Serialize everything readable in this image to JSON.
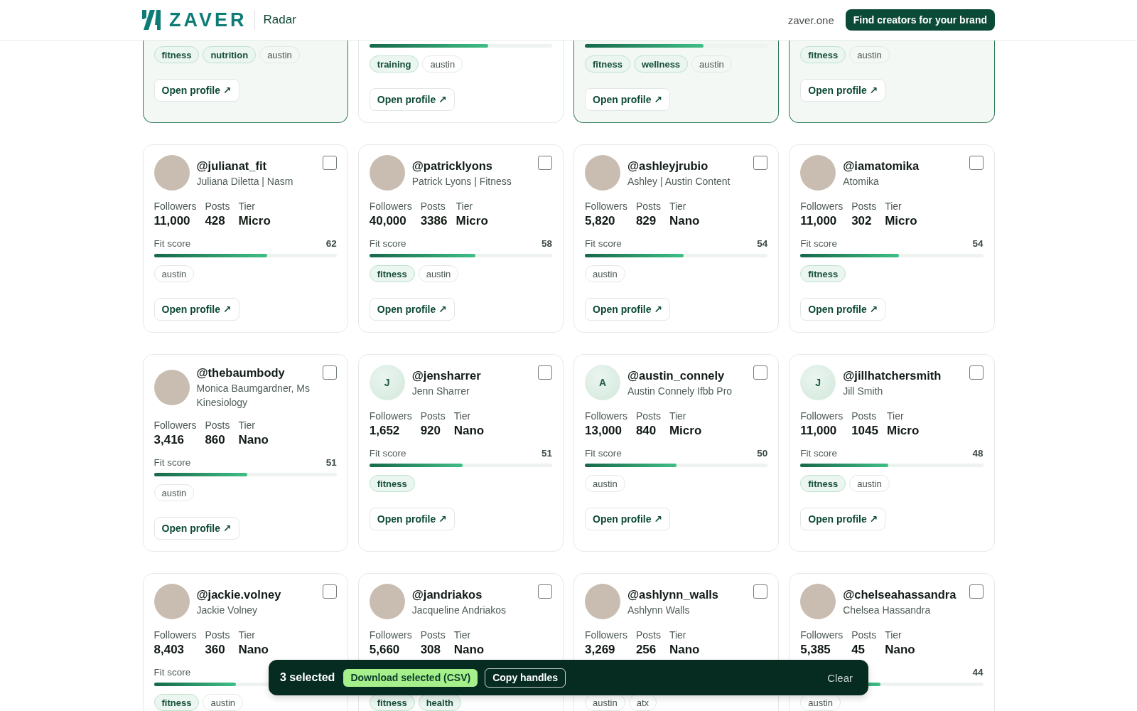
{
  "header": {
    "logo_text": "ZAVER",
    "product": "Radar",
    "site_link": "zaver.one",
    "cta": "Find creators for your brand"
  },
  "cards": [
    {
      "selected": true,
      "tags": [
        {
          "text": "fitness",
          "kind": "niche"
        },
        {
          "text": "nutrition",
          "kind": "niche"
        },
        {
          "text": "austin",
          "kind": "location"
        }
      ],
      "open_button": "Open profile ↗"
    },
    {
      "selected": false,
      "fit": {
        "level": 0.65
      },
      "tags": [
        {
          "text": "training",
          "kind": "niche"
        },
        {
          "text": "austin",
          "kind": "location"
        }
      ],
      "open_button": "Open profile ↗"
    },
    {
      "selected": true,
      "fit": {
        "level": 0.65
      },
      "tags": [
        {
          "text": "fitness",
          "kind": "niche"
        },
        {
          "text": "wellness",
          "kind": "niche"
        },
        {
          "text": "austin",
          "kind": "location"
        }
      ],
      "open_button": "Open profile ↗"
    },
    {
      "selected": true,
      "tags": [
        {
          "text": "fitness",
          "kind": "niche"
        },
        {
          "text": "austin",
          "kind": "location"
        }
      ],
      "open_button": "Open profile ↗"
    },
    {
      "selected": false,
      "avatar": {
        "kind": "photo"
      },
      "handle": "@julianat_fit",
      "name": "Juliana Diletta | Nasm",
      "checkbox": {
        "checked": false
      },
      "stats": [
        {
          "label": "Followers",
          "value": "11,000"
        },
        {
          "label": "Posts",
          "value": "428"
        },
        {
          "label": "Tier",
          "value": "Micro"
        }
      ],
      "fit": {
        "label": "Fit score",
        "score": "62",
        "level": 0.62
      },
      "tags": [
        {
          "text": "austin",
          "kind": "location"
        }
      ],
      "open_button": "Open profile ↗"
    },
    {
      "selected": false,
      "avatar": {
        "kind": "photo"
      },
      "handle": "@patricklyons",
      "name": "Patrick Lyons | Fitness",
      "checkbox": {
        "checked": false
      },
      "stats": [
        {
          "label": "Followers",
          "value": "40,000"
        },
        {
          "label": "Posts",
          "value": "3386"
        },
        {
          "label": "Tier",
          "value": "Micro"
        }
      ],
      "fit": {
        "label": "Fit score",
        "score": "58",
        "level": 0.58
      },
      "tags": [
        {
          "text": "fitness",
          "kind": "niche"
        },
        {
          "text": "austin",
          "kind": "location"
        }
      ],
      "open_button": "Open profile ↗"
    },
    {
      "selected": false,
      "avatar": {
        "kind": "photo"
      },
      "handle": "@ashleyjrubio",
      "name": "Ashley | Austin Content",
      "checkbox": {
        "checked": false
      },
      "stats": [
        {
          "label": "Followers",
          "value": "5,820"
        },
        {
          "label": "Posts",
          "value": "829"
        },
        {
          "label": "Tier",
          "value": "Nano"
        }
      ],
      "fit": {
        "label": "Fit score",
        "score": "54",
        "level": 0.54
      },
      "tags": [
        {
          "text": "austin",
          "kind": "location"
        }
      ],
      "open_button": "Open profile ↗"
    },
    {
      "selected": false,
      "avatar": {
        "kind": "photo"
      },
      "handle": "@iamatomika",
      "name": "Atomika",
      "checkbox": {
        "checked": false
      },
      "stats": [
        {
          "label": "Followers",
          "value": "11,000"
        },
        {
          "label": "Posts",
          "value": "302"
        },
        {
          "label": "Tier",
          "value": "Micro"
        }
      ],
      "fit": {
        "label": "Fit score",
        "score": "54",
        "level": 0.54
      },
      "tags": [
        {
          "text": "fitness",
          "kind": "niche"
        }
      ],
      "open_button": "Open profile ↗"
    },
    {
      "selected": false,
      "avatar": {
        "kind": "photo"
      },
      "handle": "@thebaumbody",
      "name": "Monica Baumgardner, Ms Kinesiology",
      "checkbox": {
        "checked": false
      },
      "stats": [
        {
          "label": "Followers",
          "value": "3,416"
        },
        {
          "label": "Posts",
          "value": "860"
        },
        {
          "label": "Tier",
          "value": "Nano"
        }
      ],
      "fit": {
        "label": "Fit score",
        "score": "51",
        "level": 0.51
      },
      "tags": [
        {
          "text": "austin",
          "kind": "location"
        }
      ],
      "open_button": "Open profile ↗"
    },
    {
      "selected": false,
      "avatar": {
        "kind": "initial",
        "initial": "J"
      },
      "handle": "@jensharrer",
      "name": "Jenn Sharrer",
      "checkbox": {
        "checked": false
      },
      "stats": [
        {
          "label": "Followers",
          "value": "1,652"
        },
        {
          "label": "Posts",
          "value": "920"
        },
        {
          "label": "Tier",
          "value": "Nano"
        }
      ],
      "fit": {
        "label": "Fit score",
        "score": "51",
        "level": 0.51
      },
      "tags": [
        {
          "text": "fitness",
          "kind": "niche"
        }
      ],
      "open_button": "Open profile ↗"
    },
    {
      "selected": false,
      "avatar": {
        "kind": "initial",
        "initial": "A"
      },
      "handle": "@austin_connely",
      "name": "Austin Connely Ifbb Pro",
      "checkbox": {
        "checked": false
      },
      "stats": [
        {
          "label": "Followers",
          "value": "13,000"
        },
        {
          "label": "Posts",
          "value": "840"
        },
        {
          "label": "Tier",
          "value": "Micro"
        }
      ],
      "fit": {
        "label": "Fit score",
        "score": "50",
        "level": 0.5
      },
      "tags": [
        {
          "text": "austin",
          "kind": "location"
        }
      ],
      "open_button": "Open profile ↗"
    },
    {
      "selected": false,
      "avatar": {
        "kind": "initial",
        "initial": "J"
      },
      "handle": "@jillhatchersmith",
      "name": "Jill Smith",
      "checkbox": {
        "checked": false
      },
      "stats": [
        {
          "label": "Followers",
          "value": "11,000"
        },
        {
          "label": "Posts",
          "value": "1045"
        },
        {
          "label": "Tier",
          "value": "Micro"
        }
      ],
      "fit": {
        "label": "Fit score",
        "score": "48",
        "level": 0.48
      },
      "tags": [
        {
          "text": "fitness",
          "kind": "niche"
        },
        {
          "text": "austin",
          "kind": "location"
        }
      ],
      "open_button": "Open profile ↗"
    },
    {
      "selected": false,
      "avatar": {
        "kind": "photo"
      },
      "handle": "@jackie.volney",
      "name": "Jackie Volney",
      "checkbox": {
        "checked": false
      },
      "stats": [
        {
          "label": "Followers",
          "value": "8,403"
        },
        {
          "label": "Posts",
          "value": "360"
        },
        {
          "label": "Tier",
          "value": "Nano"
        }
      ],
      "fit": {
        "label": "Fit score",
        "level": 0.45
      },
      "tags": [
        {
          "text": "fitness",
          "kind": "niche"
        },
        {
          "text": "austin",
          "kind": "location"
        }
      ]
    },
    {
      "selected": false,
      "avatar": {
        "kind": "photo"
      },
      "handle": "@jandriakos",
      "name": "Jacqueline Andriakos",
      "checkbox": {
        "checked": false
      },
      "stats": [
        {
          "label": "Followers",
          "value": "5,660"
        },
        {
          "label": "Posts",
          "value": "308"
        },
        {
          "label": "Tier",
          "value": "Nano"
        }
      ],
      "tags": [
        {
          "text": "fitness",
          "kind": "niche"
        },
        {
          "text": "health",
          "kind": "niche"
        }
      ]
    },
    {
      "selected": false,
      "avatar": {
        "kind": "photo"
      },
      "handle": "@ashlynn_walls",
      "name": "Ashlynn Walls",
      "checkbox": {
        "checked": false
      },
      "stats": [
        {
          "label": "Followers",
          "value": "3,269"
        },
        {
          "label": "Posts",
          "value": "256"
        },
        {
          "label": "Tier",
          "value": "Nano"
        }
      ],
      "tags": [
        {
          "text": "austin",
          "kind": "location"
        },
        {
          "text": "atx",
          "kind": "location"
        }
      ]
    },
    {
      "selected": false,
      "avatar": {
        "kind": "photo"
      },
      "handle": "@chelseahassandra",
      "name": "Chelsea Hassandra",
      "checkbox": {
        "checked": false
      },
      "stats": [
        {
          "label": "Followers",
          "value": "5,385"
        },
        {
          "label": "Posts",
          "value": "45"
        },
        {
          "label": "Tier",
          "value": "Nano"
        }
      ],
      "fit": {
        "score": "44",
        "level": 0.44
      },
      "tags": [
        {
          "text": "austin",
          "kind": "location"
        }
      ]
    }
  ],
  "selection_bar": {
    "count": "3 selected",
    "buttons": [
      {
        "label": "Download selected (CSV)",
        "kind": "primary"
      },
      {
        "label": "Copy handles",
        "kind": "outline"
      }
    ],
    "clear": "Clear"
  }
}
